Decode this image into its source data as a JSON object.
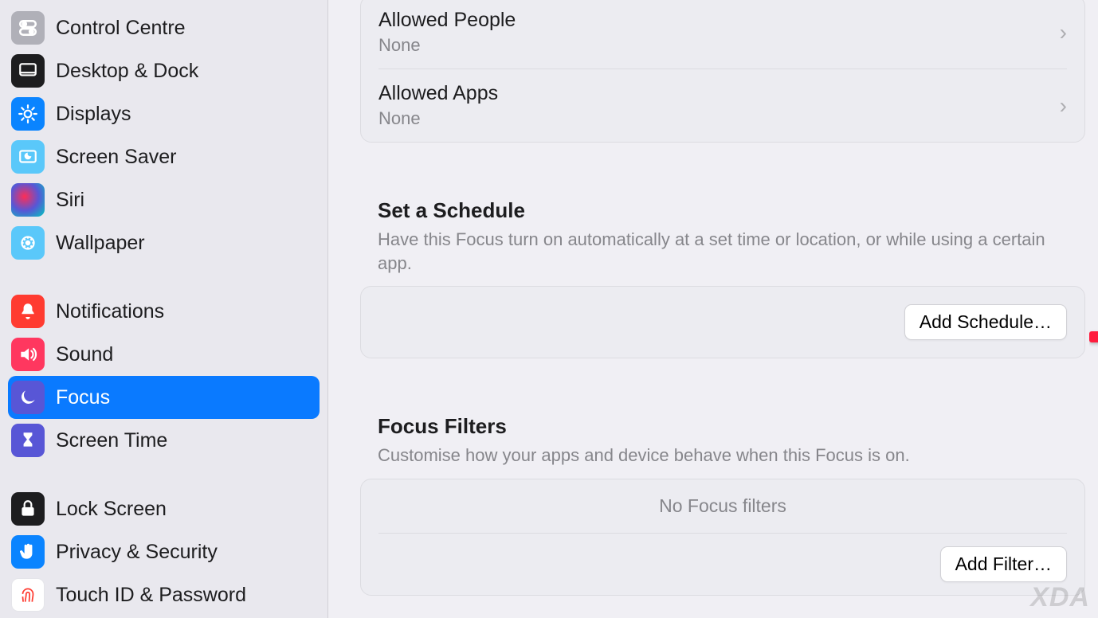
{
  "sidebar": {
    "items": [
      {
        "label": "Control Centre",
        "icon": "control-centre",
        "bg": "#b0b0b8"
      },
      {
        "label": "Desktop & Dock",
        "icon": "dock",
        "bg": "#1d1d1f"
      },
      {
        "label": "Displays",
        "icon": "displays",
        "bg": "#0a84ff"
      },
      {
        "label": "Screen Saver",
        "icon": "screensaver",
        "bg": "#5ac8fa"
      },
      {
        "label": "Siri",
        "icon": "siri",
        "bg": "#1d1d1f"
      },
      {
        "label": "Wallpaper",
        "icon": "wallpaper",
        "bg": "#5ac8fa"
      }
    ],
    "items2": [
      {
        "label": "Notifications",
        "icon": "bell",
        "bg": "#ff3b30"
      },
      {
        "label": "Sound",
        "icon": "sound",
        "bg": "#ff375f"
      },
      {
        "label": "Focus",
        "icon": "moon",
        "bg": "#5856d6",
        "selected": true
      },
      {
        "label": "Screen Time",
        "icon": "hourglass",
        "bg": "#5856d6"
      }
    ],
    "items3": [
      {
        "label": "Lock Screen",
        "icon": "lock",
        "bg": "#1d1d1f"
      },
      {
        "label": "Privacy & Security",
        "icon": "hand",
        "bg": "#0a84ff"
      },
      {
        "label": "Touch ID & Password",
        "icon": "fingerprint",
        "bg": "#ffffff"
      }
    ]
  },
  "allowed": {
    "people_title": "Allowed People",
    "people_value": "None",
    "apps_title": "Allowed Apps",
    "apps_value": "None"
  },
  "schedule": {
    "title": "Set a Schedule",
    "desc": "Have this Focus turn on automatically at a set time or location, or while using a certain app.",
    "button": "Add Schedule…"
  },
  "filters": {
    "title": "Focus Filters",
    "desc": "Customise how your apps and device behave when this Focus is on.",
    "empty": "No Focus filters",
    "button": "Add Filter…"
  },
  "watermark": "XDA"
}
